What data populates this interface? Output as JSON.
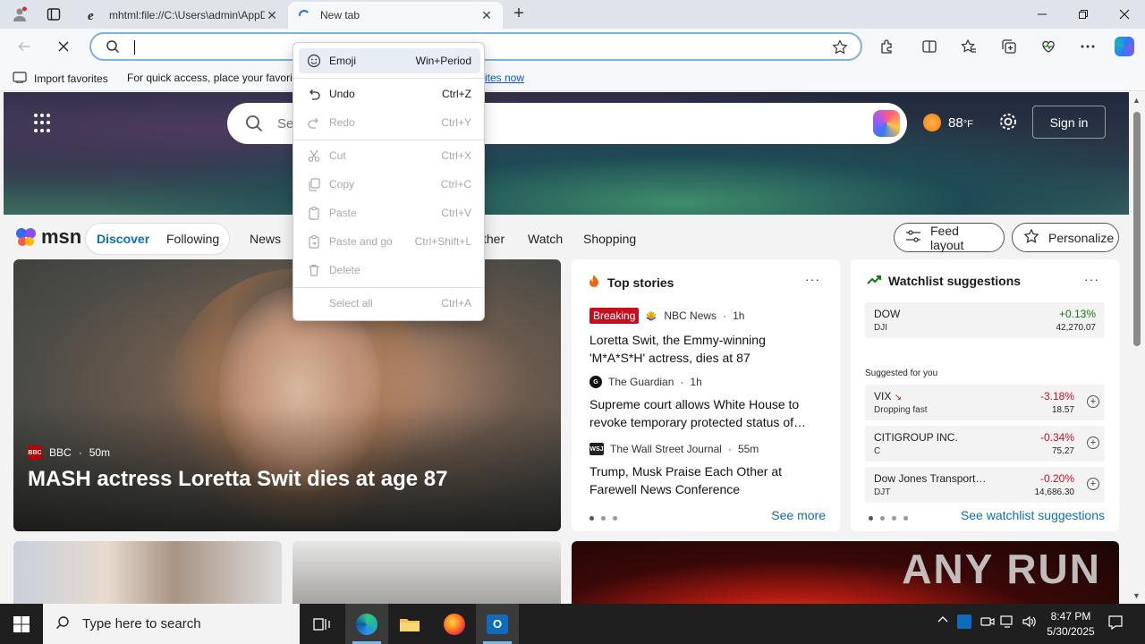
{
  "tabs": [
    {
      "title": "mhtml:file://C:\\Users\\admin\\AppData",
      "active": false
    },
    {
      "title": "New tab",
      "active": true
    }
  ],
  "address_bar": {
    "value": "",
    "placeholder": ""
  },
  "favorites_bar": {
    "import_label": "Import favorites",
    "message": "For quick access, place your favorit",
    "link_text": "rites now"
  },
  "msn": {
    "search_placeholder": "Se",
    "weather_temp": "88",
    "weather_unit": "°F",
    "signin_label": "Sign in",
    "logo_text": "msn",
    "pill_tabs": [
      "Discover",
      "Following"
    ],
    "nav_links": [
      "News",
      "ther",
      "Watch",
      "Shopping"
    ],
    "feed_layout_label": "Feed layout",
    "personalize_label": "Personalize"
  },
  "hero_story": {
    "source": "BBC",
    "age": "50m",
    "headline": "MASH actress Loretta Swit dies at age 87"
  },
  "top_stories": {
    "title": "Top stories",
    "more": "···",
    "items": [
      {
        "badge": "Breaking",
        "source": "NBC News",
        "age": "1h",
        "headline": "Loretta Swit, the Emmy-winning 'M*A*S*H' actress, dies at 87"
      },
      {
        "badge": "",
        "source": "The Guardian",
        "age": "1h",
        "headline": "Supreme court allows White House to revoke temporary protected status of…"
      },
      {
        "badge": "",
        "source": "The Wall Street Journal",
        "age": "55m",
        "headline": "Trump, Musk Praise Each Other at Farewell News Conference"
      }
    ],
    "see_more": "See more"
  },
  "watchlist": {
    "title": "Watchlist suggestions",
    "more": "···",
    "main": {
      "name": "DOW",
      "symbol": "DJI",
      "change": "+0.13%",
      "value": "42,270.07"
    },
    "suggested_label": "Suggested for you",
    "suggestions": [
      {
        "name": "VIX",
        "symbol": "Dropping fast",
        "change": "-3.18%",
        "value": "18.57"
      },
      {
        "name": "CITIGROUP INC.",
        "symbol": "C",
        "change": "-0.34%",
        "value": "75.27"
      },
      {
        "name": "Dow Jones Transport…",
        "symbol": "DJT",
        "change": "-0.20%",
        "value": "14,686.30"
      }
    ],
    "see_link": "See watchlist suggestions"
  },
  "watermark": "ANY RUN",
  "context_menu": [
    {
      "label": "Emoji",
      "shortcut": "Win+Period",
      "icon": "emoji-icon",
      "enabled": true,
      "highlighted": true
    },
    {
      "label": "Undo",
      "shortcut": "Ctrl+Z",
      "icon": "undo-icon",
      "enabled": true
    },
    {
      "label": "Redo",
      "shortcut": "Ctrl+Y",
      "icon": "redo-icon",
      "enabled": false
    },
    {
      "label": "Cut",
      "shortcut": "Ctrl+X",
      "icon": "cut-icon",
      "enabled": false
    },
    {
      "label": "Copy",
      "shortcut": "Ctrl+C",
      "icon": "copy-icon",
      "enabled": false
    },
    {
      "label": "Paste",
      "shortcut": "Ctrl+V",
      "icon": "paste-icon",
      "enabled": false
    },
    {
      "label": "Paste and go",
      "shortcut": "Ctrl+Shift+L",
      "icon": "paste-go-icon",
      "enabled": false
    },
    {
      "label": "Delete",
      "shortcut": "",
      "icon": "delete-icon",
      "enabled": false
    },
    {
      "label": "Select all",
      "shortcut": "Ctrl+A",
      "icon": "",
      "enabled": false
    }
  ],
  "taskbar": {
    "search_placeholder": "Type here to search",
    "time": "8:47 PM",
    "date": "5/30/2025"
  },
  "colors": {
    "accent": "#0f6cbd",
    "negative": "#c50f1f",
    "positive": "#107c10",
    "taskbar": "#1f1f1f"
  }
}
